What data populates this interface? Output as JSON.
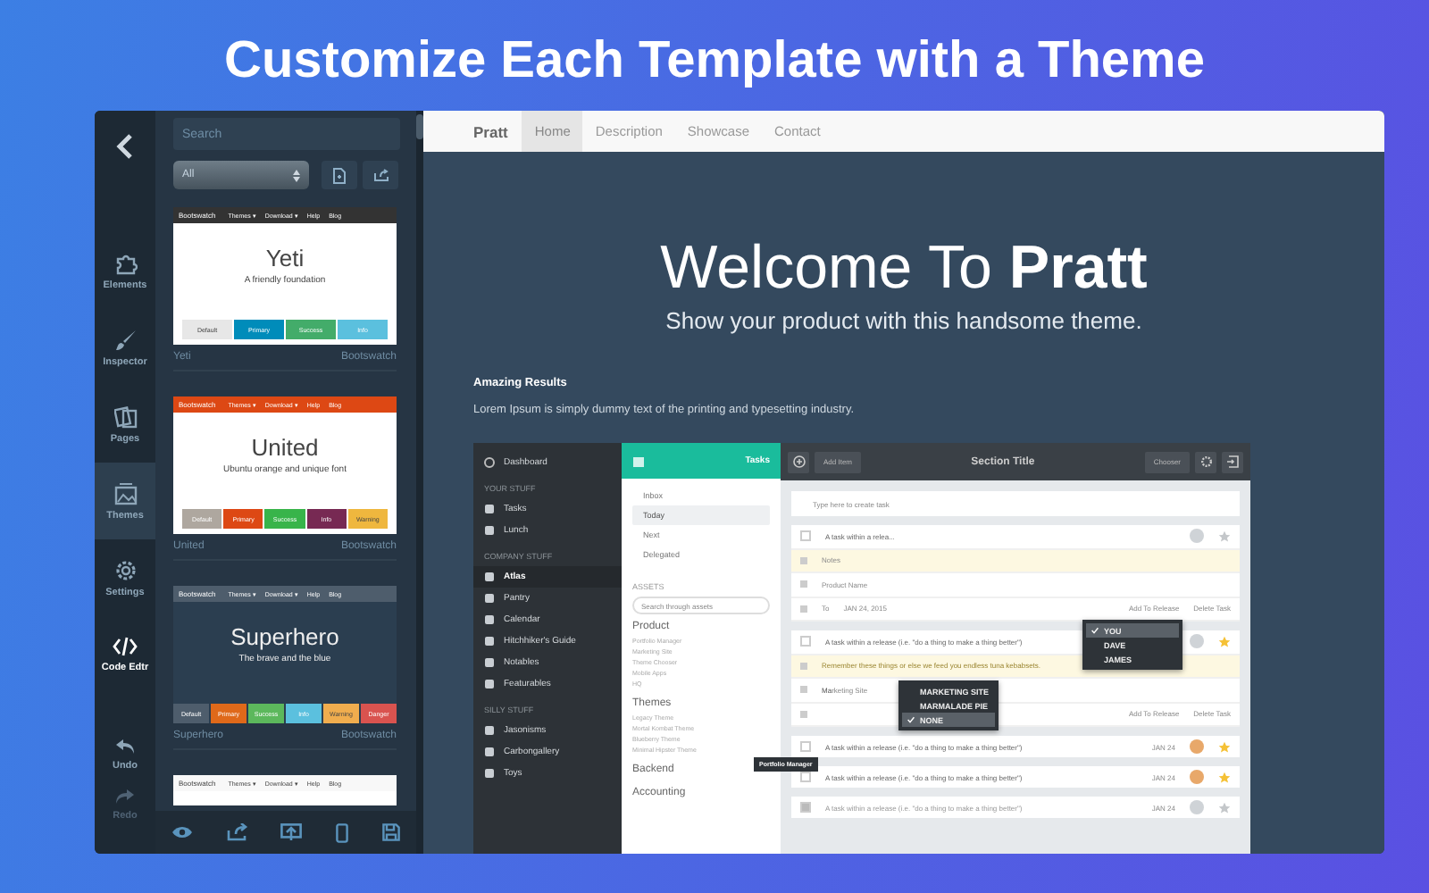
{
  "headline": "Customize Each Template with a Theme",
  "rail": {
    "items": [
      {
        "label": "Elements",
        "kind": "elements",
        "selected": false,
        "bright": false
      },
      {
        "label": "Inspector",
        "kind": "inspector",
        "selected": false,
        "bright": false
      },
      {
        "label": "Pages",
        "kind": "pages",
        "selected": false,
        "bright": false
      },
      {
        "label": "Themes",
        "kind": "themes",
        "selected": true,
        "bright": false
      },
      {
        "label": "Settings",
        "kind": "settings",
        "selected": false,
        "bright": false
      },
      {
        "label": "Code Edtr",
        "kind": "code",
        "selected": false,
        "bright": true
      }
    ],
    "history": [
      {
        "label": "Undo",
        "kind": "undo",
        "disabled": false
      },
      {
        "label": "Redo",
        "kind": "redo",
        "disabled": true
      }
    ]
  },
  "panel": {
    "search": {
      "placeholder": "Search"
    },
    "filter": {
      "value": "All"
    },
    "themes": [
      {
        "brand": "Bootswatch",
        "nav": [
          "Themes ▾",
          "Download ▾",
          "Help",
          "Blog"
        ],
        "kind": "light",
        "color": "#333333",
        "title": "Yeti",
        "tagline": "A friendly foundation",
        "name": "Yeti",
        "source": "Bootswatch",
        "buttons": [
          {
            "label": "Default",
            "color": "#e7e7e7"
          },
          {
            "label": "Primary",
            "color": "#008cba"
          },
          {
            "label": "Success",
            "color": "#43ac6a"
          },
          {
            "label": "Info",
            "color": "#5bc0de"
          }
        ]
      },
      {
        "brand": "Bootswatch",
        "nav": [
          "Themes ▾",
          "Download ▾",
          "Help",
          "Blog"
        ],
        "kind": "light",
        "color": "#dd4814",
        "title": "United",
        "tagline": "Ubuntu orange and unique font",
        "name": "United",
        "source": "Bootswatch",
        "buttons": [
          {
            "label": "Default",
            "color": "#aea79f"
          },
          {
            "label": "Primary",
            "color": "#dd4814"
          },
          {
            "label": "Success",
            "color": "#38b44a"
          },
          {
            "label": "Info",
            "color": "#772953"
          },
          {
            "label": "Warning",
            "color": "#efb73e"
          }
        ]
      },
      {
        "brand": "Bootswatch",
        "nav": [
          "Themes ▾",
          "Download ▾",
          "Help",
          "Blog"
        ],
        "kind": "dark",
        "color": "#4e5d6c",
        "title": "Superhero",
        "tagline": "The brave and the blue",
        "name": "Superhero",
        "source": "Bootswatch",
        "buttons": [
          {
            "label": "Default",
            "color": "#4e5d6c"
          },
          {
            "label": "Primary",
            "color": "#df691a"
          },
          {
            "label": "Success",
            "color": "#5cb85c"
          },
          {
            "label": "Info",
            "color": "#5bc0de"
          },
          {
            "label": "Warning",
            "color": "#f0ad4e"
          },
          {
            "label": "Danger",
            "color": "#d9534f"
          }
        ]
      },
      {
        "brand": "Bootswatch",
        "nav": [
          "Themes ▾",
          "Download ▾",
          "Help",
          "Blog"
        ],
        "kind": "light",
        "color": "#f8f8f8"
      }
    ]
  },
  "preview": {
    "brand": "Pratt",
    "nav": [
      {
        "label": "Home",
        "selected": true
      },
      {
        "label": "Description",
        "selected": false
      },
      {
        "label": "Showcase",
        "selected": false
      },
      {
        "label": "Contact",
        "selected": false
      }
    ],
    "hero_title": "Welcome To **Pratt**",
    "hero_subtitle": "Show your product with this handsome theme.",
    "heading": "Amazing Results",
    "text": "Lorem Ipsum is simply dummy text of the printing and typesetting industry.",
    "app": {
      "sidebar": {
        "top": "Dashboard",
        "groups": [
          {
            "title": "YOUR STUFF",
            "items": [
              {
                "label": "Tasks",
                "selected": false
              },
              {
                "label": "Lunch",
                "selected": false
              }
            ]
          },
          {
            "title": "COMPANY STUFF",
            "items": [
              {
                "label": "Atlas",
                "selected": true
              },
              {
                "label": "Pantry",
                "selected": false
              },
              {
                "label": "Calendar",
                "selected": false
              },
              {
                "label": "Hitchhiker's Guide",
                "selected": false
              },
              {
                "label": "Notables",
                "selected": false
              },
              {
                "label": "Featurables",
                "selected": false
              }
            ]
          },
          {
            "title": "SILLY STUFF",
            "items": [
              {
                "label": "Jasonisms",
                "selected": false
              },
              {
                "label": "Carbongallery",
                "selected": false
              },
              {
                "label": "Toys",
                "selected": false
              }
            ]
          }
        ]
      },
      "column": {
        "header": "Tasks",
        "filters": [
          {
            "label": "Inbox",
            "selected": false
          },
          {
            "label": "Today",
            "selected": true
          },
          {
            "label": "Next",
            "selected": false
          },
          {
            "label": "Delegated",
            "selected": false
          }
        ],
        "assets_label": "ASSETS",
        "search": {
          "placeholder": "Search through assets"
        },
        "groups": [
          {
            "title": "Product",
            "items": [
              "Portfolio Manager",
              "Marketing Site",
              "Theme Chooser",
              "Mobile Apps",
              "HQ"
            ]
          },
          {
            "title": "Themes",
            "items": [
              "Legacy Theme",
              "Mortal Kombat Theme",
              "Blueberry Theme",
              "Minimal Hipster Theme"
            ]
          },
          {
            "title": "Backend"
          },
          {
            "title": "Accounting"
          }
        ],
        "tooltip": "Portfolio Manager"
      },
      "toolbar": {
        "add": "Add Item",
        "title": "Section Title",
        "chooser": "Chooser"
      },
      "new_task": {
        "placeholder": "Type here to create task"
      },
      "tasks": [
        {
          "kind": "card",
          "title": "A task within a relea...",
          "notes": {
            "placeholder": "Notes"
          },
          "product": {
            "placeholder": "Product Name"
          },
          "assignee": "To",
          "date": "JAN 24, 2015",
          "actions": [
            "Add To Release",
            "Delete Task"
          ],
          "starred": false,
          "done": false
        },
        {
          "kind": "card",
          "title": "A task within a release (i.e. \"do a thing to make a thing better\")",
          "notes": {
            "value": "Remember these things or else we feed you endless tuna kebabsets."
          },
          "product": {
            "value": "Ma",
            "suggestion": "rketing Site"
          },
          "actions": [
            "Add To Release",
            "Delete Task"
          ],
          "starred": true,
          "done": false,
          "product_menu": [
            {
              "label": "MARKETING SITE",
              "checked": false
            },
            {
              "label": "MARMALADE PIE",
              "checked": false
            },
            {
              "label": "NONE",
              "checked": true
            }
          ],
          "assignee_menu": [
            {
              "label": "YOU",
              "checked": true
            },
            {
              "label": "DAVE",
              "checked": false
            },
            {
              "label": "JAMES",
              "checked": false
            }
          ]
        },
        {
          "kind": "row",
          "title": "A task within a release (i.e. \"do a thing to make a thing better\")",
          "date": "JAN 24",
          "starred": true,
          "done": false
        },
        {
          "kind": "row",
          "title": "A task within a release (i.e. \"do a thing to make a thing better\")",
          "date": "JAN 24",
          "starred": true,
          "done": false
        },
        {
          "kind": "row",
          "title": "A task within a release (i.e. \"do a thing to make a thing better\")",
          "date": "JAN 24",
          "starred": false,
          "done": true
        }
      ]
    }
  }
}
